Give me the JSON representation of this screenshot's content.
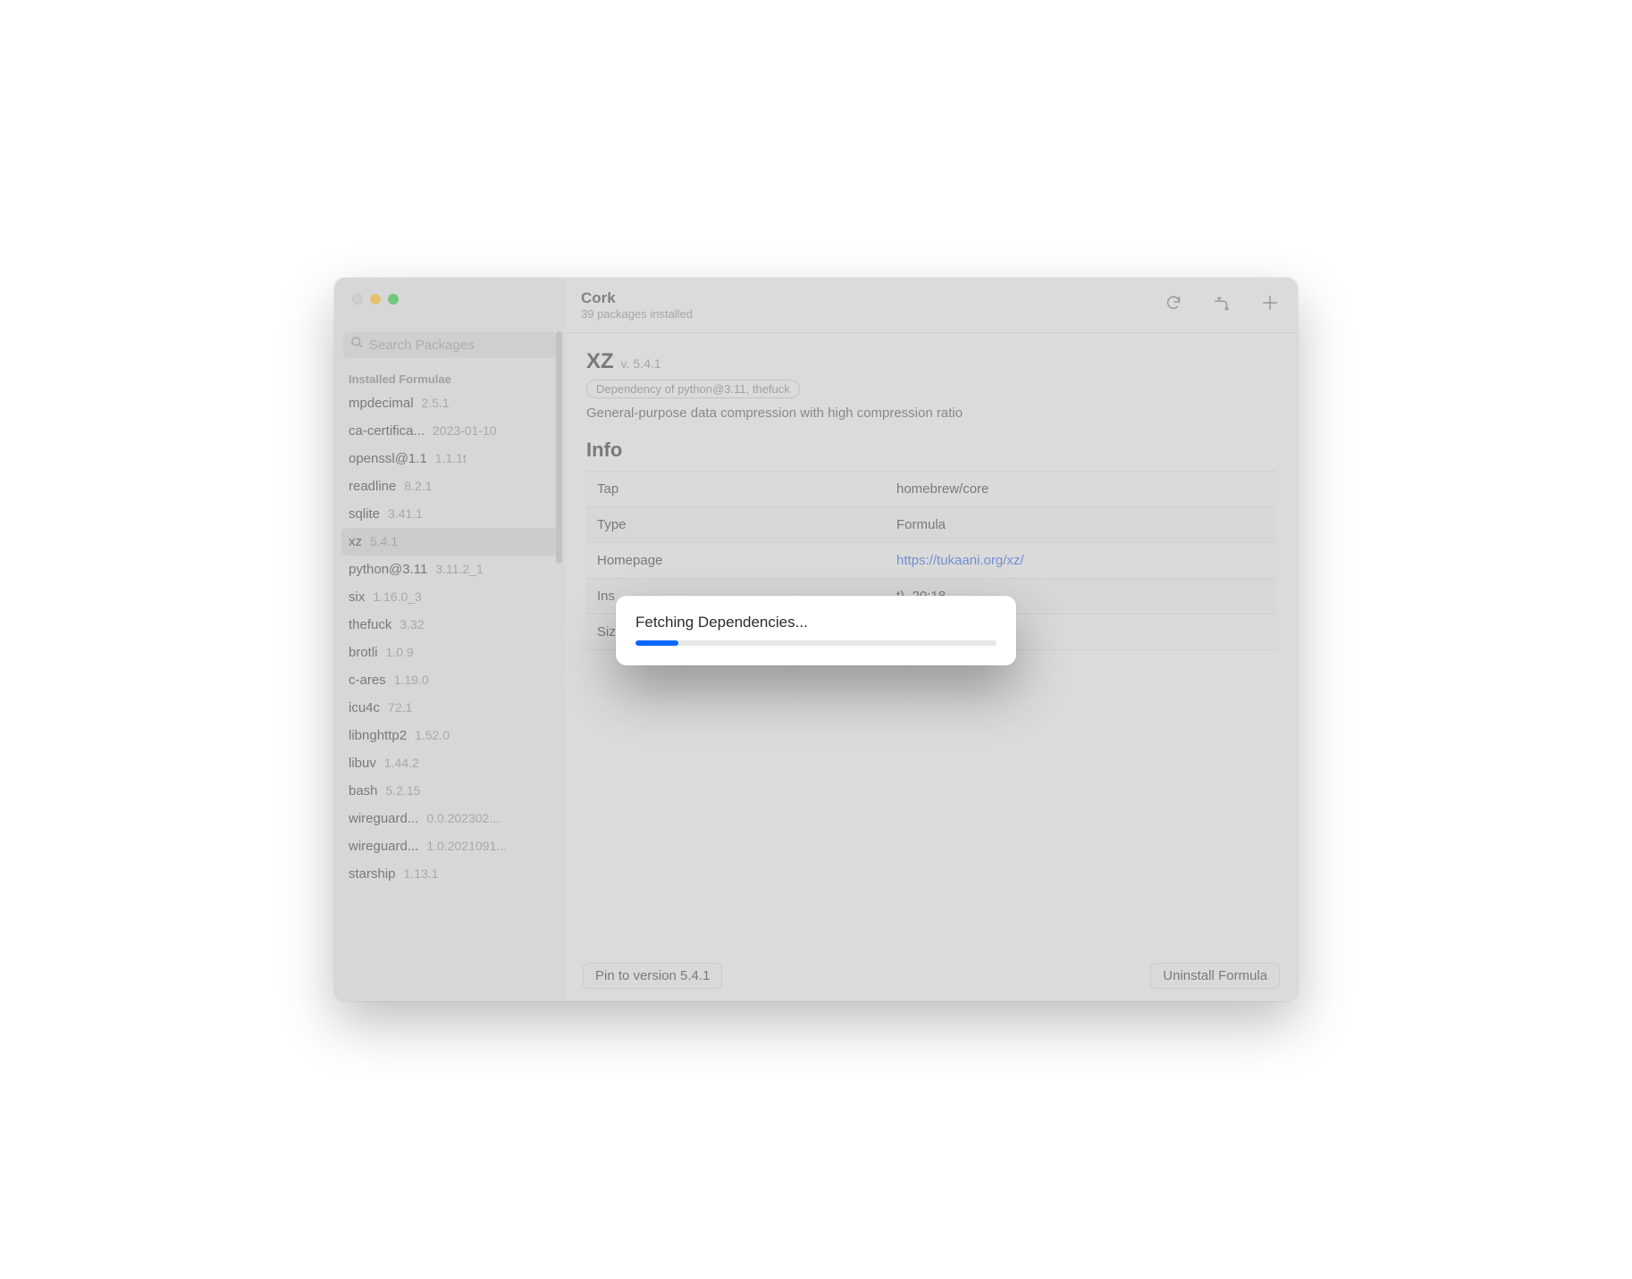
{
  "app": {
    "title": "Cork",
    "subtitle": "39 packages installed"
  },
  "search": {
    "placeholder": "Search Packages"
  },
  "sidebar": {
    "section_label": "Installed Formulae",
    "items": [
      {
        "name": "mpdecimal",
        "version": "2.5.1",
        "selected": false
      },
      {
        "name": "ca-certifica...",
        "version": "2023-01-10",
        "selected": false
      },
      {
        "name": "openssl@1.1",
        "version": "1.1.1t",
        "selected": false
      },
      {
        "name": "readline",
        "version": "8.2.1",
        "selected": false
      },
      {
        "name": "sqlite",
        "version": "3.41.1",
        "selected": false
      },
      {
        "name": "xz",
        "version": "5.4.1",
        "selected": true
      },
      {
        "name": "python@3.11",
        "version": "3.11.2_1",
        "selected": false
      },
      {
        "name": "six",
        "version": "1.16.0_3",
        "selected": false
      },
      {
        "name": "thefuck",
        "version": "3.32",
        "selected": false
      },
      {
        "name": "brotli",
        "version": "1.0.9",
        "selected": false
      },
      {
        "name": "c-ares",
        "version": "1.19.0",
        "selected": false
      },
      {
        "name": "icu4c",
        "version": "72.1",
        "selected": false
      },
      {
        "name": "libnghttp2",
        "version": "1.52.0",
        "selected": false
      },
      {
        "name": "libuv",
        "version": "1.44.2",
        "selected": false
      },
      {
        "name": "bash",
        "version": "5.2.15",
        "selected": false
      },
      {
        "name": "wireguard...",
        "version": "0.0.202302...",
        "selected": false
      },
      {
        "name": "wireguard...",
        "version": "1.0.2021091...",
        "selected": false
      },
      {
        "name": "starship",
        "version": "1.13.1",
        "selected": false
      }
    ]
  },
  "detail": {
    "name": "XZ",
    "version_prefix": "v.",
    "version": "5.4.1",
    "dependency_badge": "Dependency of python@3.11, thefuck",
    "description": "General-purpose data compression with high compression ratio",
    "info_header": "Info",
    "rows": [
      {
        "key": "Tap",
        "value": "homebrew/core",
        "link": false
      },
      {
        "key": "Type",
        "value": "Formula",
        "link": false
      },
      {
        "key": "Homepage",
        "value": "https://tukaani.org/xz/",
        "link": true
      },
      {
        "key": "Ins",
        "value": "t), 20:18",
        "link": false
      },
      {
        "key": "Siz",
        "value": "",
        "link": false
      }
    ]
  },
  "footer": {
    "pin_label": "Pin to version 5.4.1",
    "uninstall_label": "Uninstall Formula"
  },
  "modal": {
    "title": "Fetching Dependencies...",
    "progress_percent": 12
  }
}
